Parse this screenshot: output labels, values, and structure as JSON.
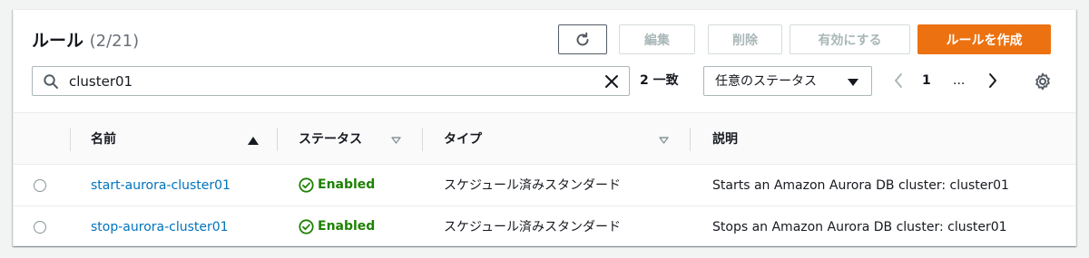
{
  "header": {
    "title": "ルール",
    "count": "(2/21)",
    "buttons": {
      "edit": "編集",
      "delete": "削除",
      "enable": "有効にする",
      "create": "ルールを作成"
    }
  },
  "filter": {
    "search_value": "cluster01",
    "matches": "2 一致",
    "status_select": "任意のステータス"
  },
  "pagination": {
    "current_page": "1",
    "ellipsis": "..."
  },
  "table": {
    "columns": [
      "名前",
      "ステータス",
      "タイプ",
      "説明"
    ],
    "rows": [
      {
        "name": "start-aurora-cluster01",
        "status": "Enabled",
        "type": "スケジュール済みスタンダード",
        "description": "Starts an Amazon Aurora DB cluster: cluster01"
      },
      {
        "name": "stop-aurora-cluster01",
        "status": "Enabled",
        "type": "スケジュール済みスタンダード",
        "description": "Stops an Amazon Aurora DB cluster: cluster01"
      }
    ]
  },
  "colors": {
    "primary": "#ec7211",
    "link": "#0073bb",
    "success": "#1d8102",
    "border": "#aab7b8"
  },
  "icons": [
    "refresh-icon",
    "search-icon",
    "clear-icon",
    "caret-down-icon",
    "chevron-left-icon",
    "chevron-right-icon",
    "gear-icon",
    "sort-ascending-icon",
    "sort-icon",
    "check-circle-icon"
  ]
}
